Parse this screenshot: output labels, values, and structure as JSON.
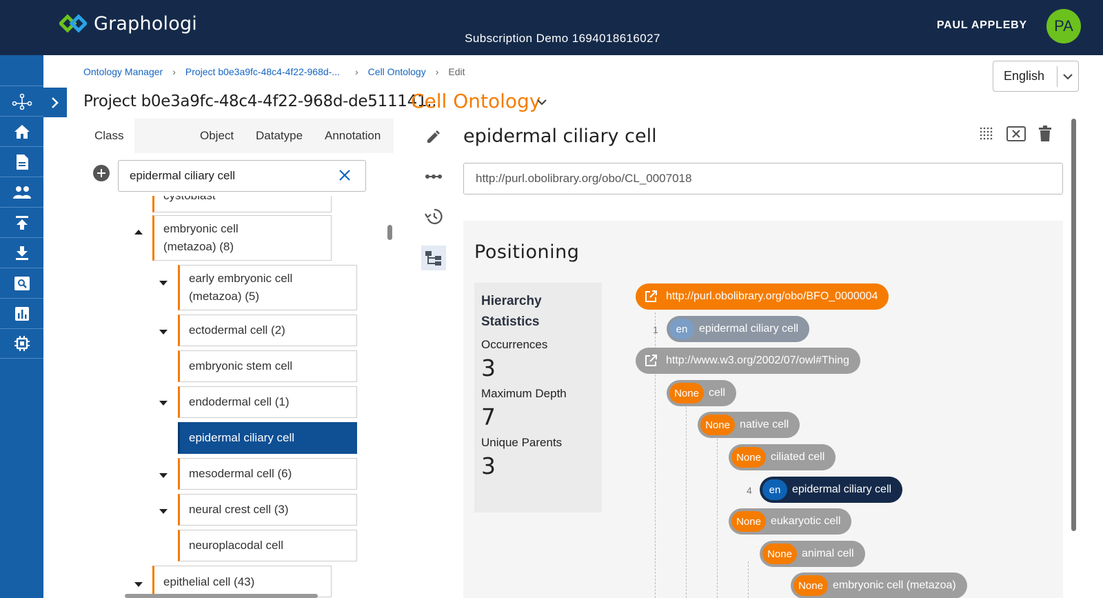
{
  "header": {
    "app_name": "Graphologi",
    "subscription": "Subscription Demo 1694018616027",
    "user_name": "PAUL APPLEBY",
    "user_initials": "PA"
  },
  "sidebar": {
    "items": [
      {
        "name": "graph"
      },
      {
        "name": "home"
      },
      {
        "name": "document"
      },
      {
        "name": "users"
      },
      {
        "name": "upload"
      },
      {
        "name": "download"
      },
      {
        "name": "search"
      },
      {
        "name": "chart"
      },
      {
        "name": "settings-chip"
      }
    ]
  },
  "breadcrumb": {
    "items": [
      "Ontology Manager",
      "Project b0e3a9fc-48c4-4f22-968d-...",
      "Cell Ontology"
    ],
    "current": "Edit"
  },
  "language": {
    "selected": "English"
  },
  "project_title": "Project b0e3a9fc-48c4-4f22-968d-de511141...",
  "ontology_title": "Cell Ontology",
  "left_panel": {
    "tabs": [
      "Class",
      "Object",
      "Datatype",
      "Annotation"
    ],
    "active_tab": "Class",
    "search": {
      "value": "epidermal ciliary cell",
      "placeholder": ""
    },
    "tree": [
      {
        "label": "cystoblast"
      },
      {
        "label": "embryonic cell (metazoa) (8)",
        "line1": "embryonic cell",
        "line2": "(metazoa) (8)"
      },
      {
        "label": "early embryonic cell (metazoa) (5)",
        "line1": "early embryonic cell",
        "line2": "(metazoa) (5)"
      },
      {
        "label": "ectodermal cell (2)"
      },
      {
        "label": "embryonic stem cell"
      },
      {
        "label": "endodermal cell (1)"
      },
      {
        "label": "epidermal ciliary cell",
        "selected": true
      },
      {
        "label": "mesodermal cell (6)"
      },
      {
        "label": "neural crest cell (3)"
      },
      {
        "label": "neuroplacodal cell"
      },
      {
        "label": "epithelial cell (43)"
      }
    ]
  },
  "editor": {
    "entity_title": "epidermal ciliary cell",
    "iri": "http://purl.obolibrary.org/obo/CL_0007018",
    "positioning": {
      "title": "Positioning",
      "stats": {
        "heading_line1": "Hierarchy",
        "heading_line2": "Statistics",
        "occurrences_label": "Occurrences",
        "occurrences": "3",
        "max_depth_label": "Maximum Depth",
        "max_depth": "7",
        "unique_parents_label": "Unique Parents",
        "unique_parents": "3"
      },
      "hierarchy": [
        {
          "kind": "iri",
          "label": "http://purl.obolibrary.org/obo/BFO_0000004",
          "color": "#f57c00"
        },
        {
          "kind": "lang",
          "lang": "en",
          "label": "epidermal ciliary cell",
          "depth": "1"
        },
        {
          "kind": "iri",
          "label": "http://www.w3.org/2002/07/owl#Thing",
          "color": "#9e9e9e"
        },
        {
          "kind": "lang",
          "lang": "None",
          "label": "cell"
        },
        {
          "kind": "lang",
          "lang": "None",
          "label": "native cell"
        },
        {
          "kind": "lang",
          "lang": "None",
          "label": "ciliated cell"
        },
        {
          "kind": "lang",
          "lang": "en",
          "label": "epidermal ciliary cell",
          "depth": "4"
        },
        {
          "kind": "lang",
          "lang": "None",
          "label": "eukaryotic cell"
        },
        {
          "kind": "lang",
          "lang": "None",
          "label": "animal cell"
        },
        {
          "kind": "lang",
          "lang": "None",
          "label": "embryonic cell (metazoa)"
        }
      ]
    }
  },
  "colors": {
    "header_bg": "#152a4a",
    "sidebar_bg": "#1660a8",
    "accent_orange": "#f57c00",
    "selected_blue": "#0f4f94",
    "avatar_green": "#6cc11e"
  }
}
